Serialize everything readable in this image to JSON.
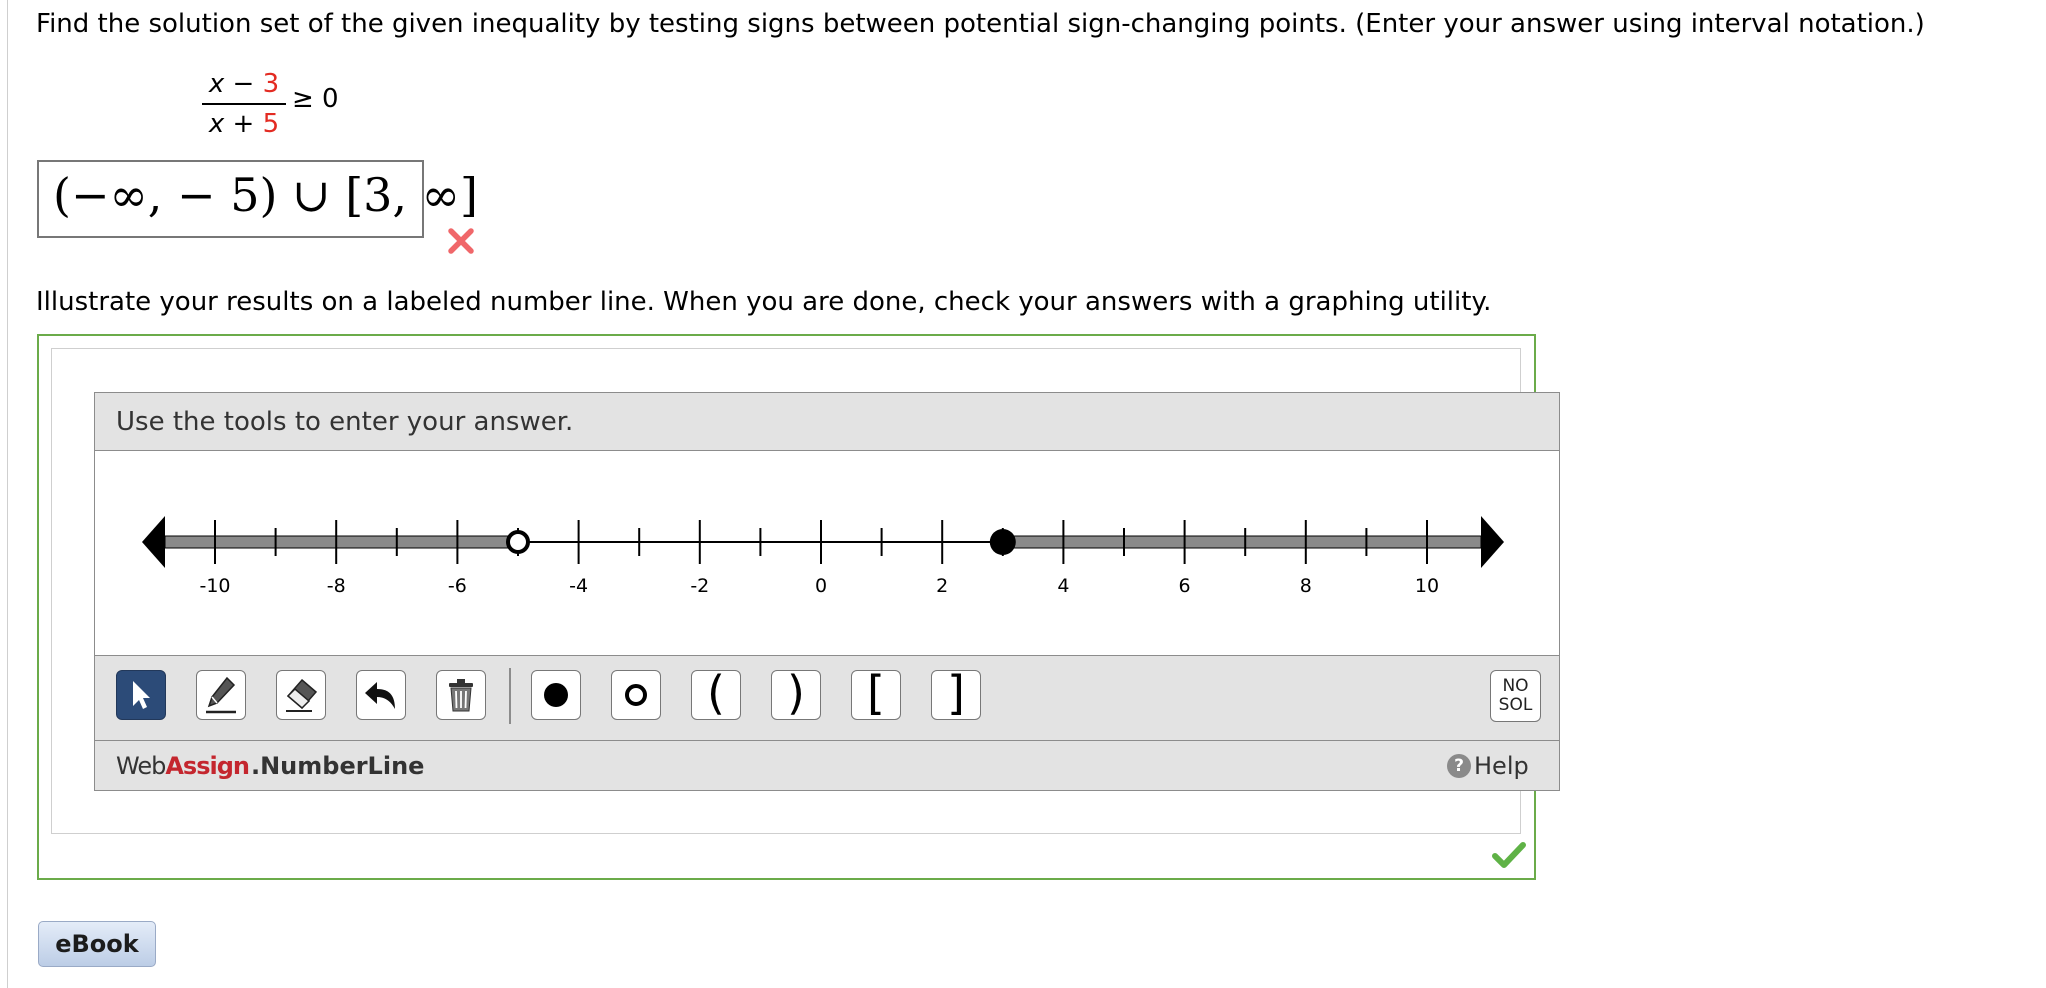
{
  "question": {
    "prompt": "Find the solution set of the given inequality by testing signs between potential sign-changing points. (Enter your answer using interval notation.)",
    "inequality": {
      "numerator_var": "x",
      "numerator_op": " − ",
      "numerator_const": "3",
      "denominator_var": "x",
      "denominator_op": " + ",
      "denominator_const": "5",
      "relation": "≥ 0"
    },
    "answer_value": "(−∞, − 5) ∪ [3, ∞]",
    "answer_status_icon": "x-icon",
    "illustrate_prompt": "Illustrate your results on a labeled number line. When you are done, check your answers with a graphing utility."
  },
  "widget": {
    "header": "Use the tools to enter your answer.",
    "number_line": {
      "min": -10,
      "max": 10,
      "tick_labels": [
        "-10",
        "-8",
        "-6",
        "-4",
        "-2",
        "0",
        "2",
        "4",
        "6",
        "8",
        "10"
      ],
      "tick_values": [
        -10,
        -8,
        -6,
        -4,
        -2,
        0,
        2,
        4,
        6,
        8,
        10
      ],
      "shaded_segments": [
        {
          "from": "-inf",
          "to": -5
        },
        {
          "from": 3,
          "to": "inf"
        }
      ],
      "points": [
        {
          "value": -5,
          "style": "open"
        },
        {
          "value": 3,
          "style": "closed"
        }
      ]
    },
    "tools": [
      {
        "name": "pointer-tool",
        "icon": "arrow-pointer-icon"
      },
      {
        "name": "pencil-tool",
        "icon": "pencil-icon"
      },
      {
        "name": "eraser-tool",
        "icon": "eraser-icon"
      },
      {
        "name": "undo-tool",
        "icon": "undo-icon"
      },
      {
        "name": "trash-tool",
        "icon": "trash-icon"
      },
      {
        "name": "closed-point-tool",
        "icon": "filled-circle-icon"
      },
      {
        "name": "open-point-tool",
        "icon": "open-circle-icon"
      },
      {
        "name": "left-paren-tool",
        "label": "("
      },
      {
        "name": "right-paren-tool",
        "label": ")"
      },
      {
        "name": "left-bracket-tool",
        "label": "["
      },
      {
        "name": "right-bracket-tool",
        "label": "]"
      }
    ],
    "no_solution": {
      "line1": "NO",
      "line2": "SOL"
    },
    "footer": {
      "brand_web": "Web",
      "brand_assign": "Assign",
      "brand_product": ".NumberLine",
      "help": "Help"
    },
    "status_icon": "checkmark-icon"
  },
  "ebook_label": "eBook",
  "colors": {
    "accent_red": "#e32b22",
    "frame_green": "#6bab4a",
    "tool_active": "#2c4b78",
    "brand_red": "#c4262e"
  }
}
